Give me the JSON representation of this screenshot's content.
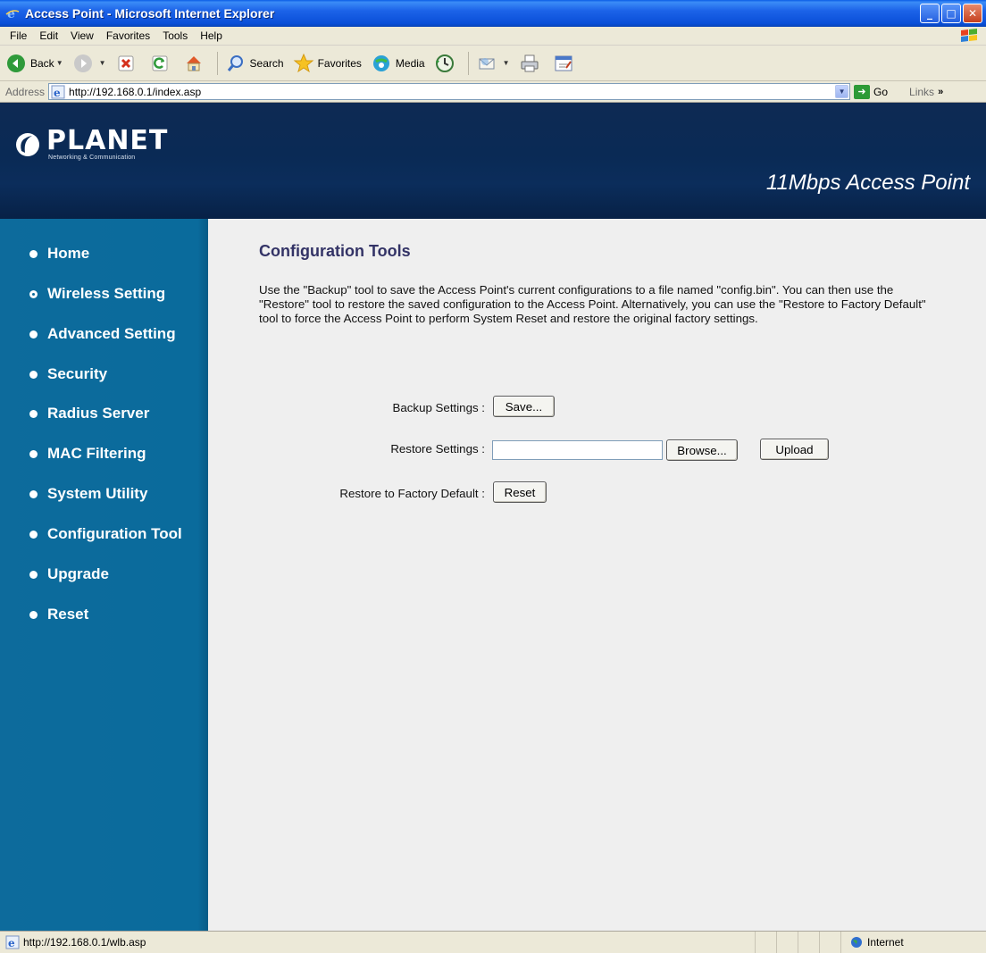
{
  "window": {
    "title": "Access Point - Microsoft Internet Explorer",
    "controls": [
      "minimize",
      "maximize",
      "close"
    ]
  },
  "menu": [
    "File",
    "Edit",
    "View",
    "Favorites",
    "Tools",
    "Help"
  ],
  "toolbar": {
    "back": "Back",
    "search": "Search",
    "favorites": "Favorites",
    "media": "Media"
  },
  "address": {
    "label": "Address",
    "url": "http://192.168.0.1/index.asp",
    "go": "Go",
    "links": "Links"
  },
  "header": {
    "brand": "PLANET",
    "tagline": "Networking & Communication",
    "product": "11Mbps Access Point",
    "bg_color": "#0a2a55"
  },
  "sidebar": {
    "bg_color": "#0b6a9a",
    "items": [
      {
        "label": "Home",
        "active": false
      },
      {
        "label": "Wireless Setting",
        "active": true
      },
      {
        "label": "Advanced Setting",
        "active": false
      },
      {
        "label": "Security",
        "active": false
      },
      {
        "label": "Radius Server",
        "active": false
      },
      {
        "label": "MAC Filtering",
        "active": false
      },
      {
        "label": "System Utility",
        "active": false
      },
      {
        "label": "Configuration Tool",
        "active": false
      },
      {
        "label": "Upgrade",
        "active": false
      },
      {
        "label": "Reset",
        "active": false
      }
    ]
  },
  "main": {
    "title": "Configuration Tools",
    "description": "Use the \"Backup\" tool to save the Access Point's current configurations to a file named \"config.bin\". You can then use the \"Restore\" tool to restore the saved configuration to the Access Point. Alternatively, you can use the \"Restore to Factory Default\" tool to force the Access Point to perform System Reset and restore the original factory settings.",
    "backup": {
      "label": "Backup Settings :",
      "button": "Save..."
    },
    "restore": {
      "label": "Restore Settings :",
      "file_value": "",
      "browse": "Browse...",
      "upload": "Upload"
    },
    "factory": {
      "label": "Restore to Factory Default :",
      "button": "Reset"
    }
  },
  "status": {
    "url": "http://192.168.0.1/wlb.asp",
    "zone": "Internet"
  }
}
